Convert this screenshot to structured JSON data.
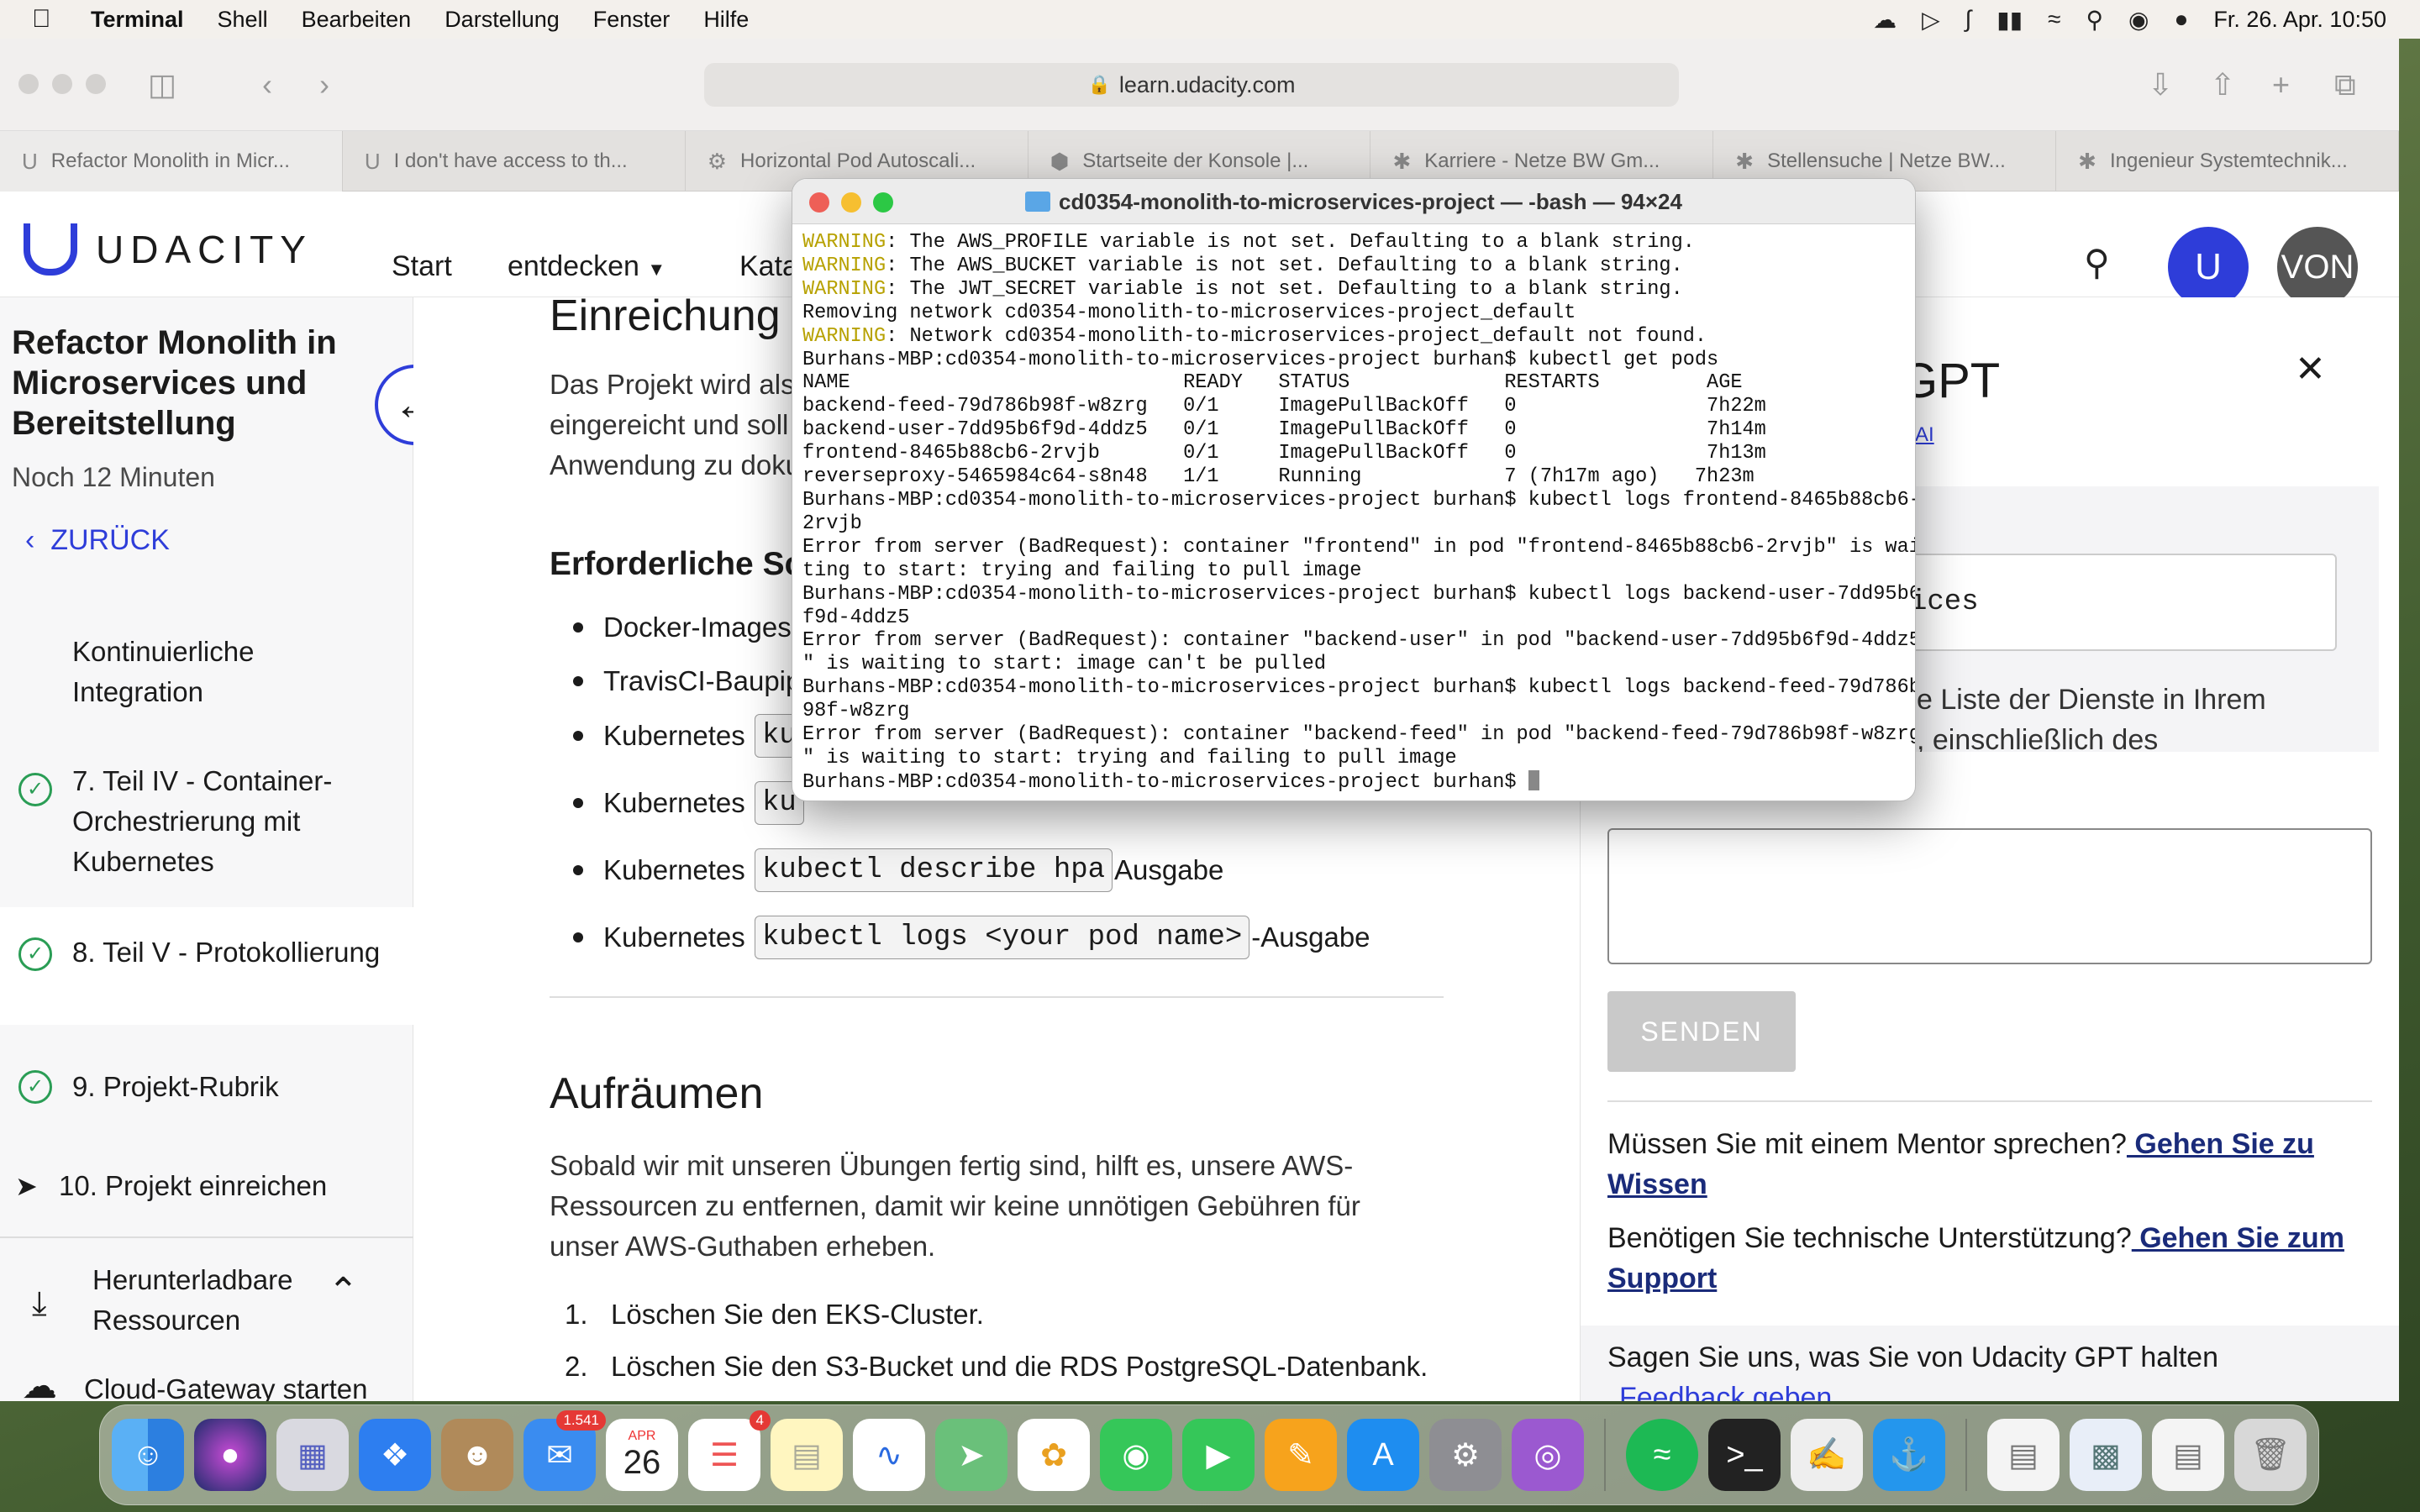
{
  "menubar": {
    "app": "Terminal",
    "items": [
      "Shell",
      "Bearbeiten",
      "Darstellung",
      "Fenster",
      "Hilfe"
    ],
    "datetime": "Fr. 26. Apr.  10:50"
  },
  "browser": {
    "url": "learn.udacity.com",
    "tabs": [
      "Refactor Monolith in Micr...",
      "I don't have access to th...",
      "Horizontal Pod Autoscali...",
      "Startseite der Konsole |...",
      "Karriere - Netze BW Gm...",
      "Stellensuche | Netze BW...",
      "Ingenieur Systemtechnik..."
    ]
  },
  "site": {
    "logo": "UDACITY",
    "nav": [
      "Start",
      "entdecken",
      "Kata"
    ],
    "avatar": "VON"
  },
  "sidebar": {
    "title": "Refactor Monolith in Microservices und Bereitstellung",
    "subtitle": "Noch 12 Minuten",
    "back": "ZURÜCK",
    "items": [
      {
        "label": "Kontinuierliche Integration"
      },
      {
        "label": "7. Teil IV - Container-Orchestrierung mit Kubernetes"
      },
      {
        "label": "8. Teil V - Protokollierung"
      },
      {
        "label": "9. Projekt-Rubrik"
      },
      {
        "label": "10. Projekt einreichen"
      }
    ],
    "downloads": "Herunterladbare Ressourcen",
    "cloud": "Cloud-Gateway starten"
  },
  "content": {
    "h_submit": "Einreichung",
    "p1": [
      "Das Projekt wird als",
      "eingereicht und soll",
      "Anwendung zu doku"
    ],
    "h_req": "Erforderliche Sc",
    "bullets": [
      "Docker-Images",
      "TravisCI-Baupip",
      "Kubernetes",
      "Kubernetes"
    ],
    "bullet_hpa_pre": "Kubernetes",
    "bullet_hpa_code": "kubectl describe hpa",
    "bullet_hpa_post": "Ausgabe",
    "bullet_logs_pre": "Kubernetes",
    "bullet_logs_code": "kubectl logs <your pod name>",
    "bullet_logs_post": "-Ausgabe",
    "code_trunc": "ku",
    "h_cleanup": "Aufräumen",
    "p2": [
      "Sobald wir mit unseren Übungen fertig sind, hilft es, unsere AWS-",
      "Ressourcen zu entfernen, damit wir keine unnötigen Gebühren für",
      "unser AWS-Guthaben erheben."
    ],
    "ol": [
      "Löschen Sie den EKS-Cluster.",
      "Löschen Sie den S3-Bucket und die RDS PostgreSQL-Datenbank."
    ]
  },
  "gpt": {
    "title_frag": "GPT",
    "ai_frag": "AI",
    "input_frag": "ices",
    "text1": "e Liste der Dienste in Ihrem",
    "text2": ", einschließlich des",
    "send": "SENDEN",
    "mentor_q": "Müssen Sie mit einem Mentor sprechen?",
    "mentor_link": " Gehen Sie zu Wissen",
    "support_q": "Benötigen Sie technische Unterstützung?",
    "support_link": " Gehen Sie zum Support",
    "feedback_q": "Sagen Sie uns, was Sie von Udacity GPT halten",
    "feedback_link": "Feedback geben"
  },
  "terminal": {
    "title": "cd0354-monolith-to-microservices-project — -bash — 94×24",
    "lines": [
      {
        "w": "WARNING",
        "t": ": The AWS_PROFILE variable is not set. Defaulting to a blank string."
      },
      {
        "w": "WARNING",
        "t": ": The AWS_BUCKET variable is not set. Defaulting to a blank string."
      },
      {
        "w": "WARNING",
        "t": ": The JWT_SECRET variable is not set. Defaulting to a blank string."
      },
      {
        "w": "",
        "t": "Removing network cd0354-monolith-to-microservices-project_default"
      },
      {
        "w": "WARNING",
        "t": ": Network cd0354-monolith-to-microservices-project_default not found."
      },
      {
        "w": "",
        "t": "Burhans-MBP:cd0354-monolith-to-microservices-project burhan$ kubectl get pods"
      },
      {
        "w": "",
        "t": "NAME                            READY   STATUS             RESTARTS         AGE"
      },
      {
        "w": "",
        "t": "backend-feed-79d786b98f-w8zrg   0/1     ImagePullBackOff   0                7h22m"
      },
      {
        "w": "",
        "t": "backend-user-7dd95b6f9d-4ddz5   0/1     ImagePullBackOff   0                7h14m"
      },
      {
        "w": "",
        "t": "frontend-8465b88cb6-2rvjb       0/1     ImagePullBackOff   0                7h13m"
      },
      {
        "w": "",
        "t": "reverseproxy-5465984c64-s8n48   1/1     Running            7 (7h17m ago)   7h23m"
      },
      {
        "w": "",
        "t": "Burhans-MBP:cd0354-monolith-to-microservices-project burhan$ kubectl logs frontend-8465b88cb6-"
      },
      {
        "w": "",
        "t": "2rvjb"
      },
      {
        "w": "",
        "t": "Error from server (BadRequest): container \"frontend\" in pod \"frontend-8465b88cb6-2rvjb\" is wai"
      },
      {
        "w": "",
        "t": "ting to start: trying and failing to pull image"
      },
      {
        "w": "",
        "t": "Burhans-MBP:cd0354-monolith-to-microservices-project burhan$ kubectl logs backend-user-7dd95b6"
      },
      {
        "w": "",
        "t": "f9d-4ddz5"
      },
      {
        "w": "",
        "t": "Error from server (BadRequest): container \"backend-user\" in pod \"backend-user-7dd95b6f9d-4ddz5"
      },
      {
        "w": "",
        "t": "\" is waiting to start: image can't be pulled"
      },
      {
        "w": "",
        "t": "Burhans-MBP:cd0354-monolith-to-microservices-project burhan$ kubectl logs backend-feed-79d786b"
      },
      {
        "w": "",
        "t": "98f-w8zrg"
      },
      {
        "w": "",
        "t": "Error from server (BadRequest): container \"backend-feed\" in pod \"backend-feed-79d786b98f-w8zrg"
      },
      {
        "w": "",
        "t": "\" is waiting to start: trying and failing to pull image"
      },
      {
        "w": "",
        "t": "Burhans-MBP:cd0354-monolith-to-microservices-project burhan$ "
      }
    ]
  },
  "dock": {
    "mail_badge": "1.541",
    "cal_month": "APR",
    "cal_day": "26",
    "reminders_badge": "4"
  }
}
